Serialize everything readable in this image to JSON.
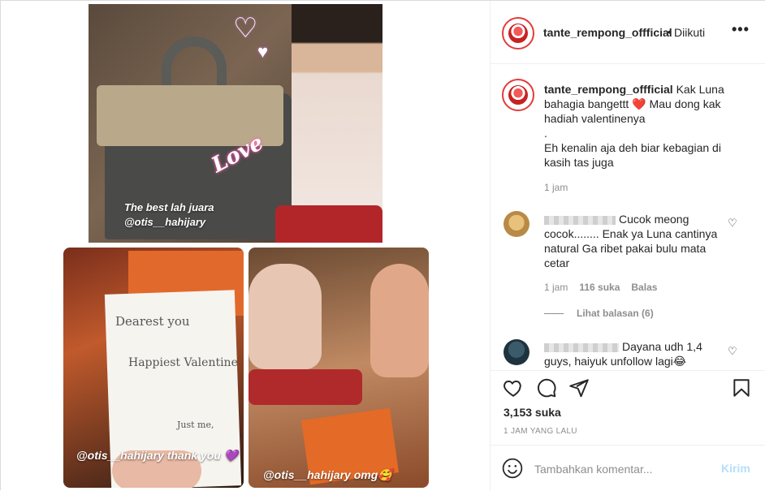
{
  "media": {
    "top_caption_1": "The best lah juara",
    "top_caption_2": "@otis__hahijary",
    "love_sticker": "Love",
    "card_line_1": "Dearest you",
    "card_line_2": "Happiest Valentine",
    "card_line_3": "Just me,",
    "bl_caption": "@otis__hahijary thank you 💜",
    "br_caption": "@otis__hahijary omg🥰"
  },
  "header": {
    "username": "tante_rempong_offficial",
    "separator": "•",
    "follow_label": "Diikuti",
    "more_icon": "more-horizontal-icon"
  },
  "caption": {
    "username": "tante_rempong_offficial",
    "text_1": "Kak Luna bahagia bangettt",
    "heart": "❤️",
    "text_2": "Mau dong kak hadiah valentinenya\n.\nEh kenalin aja deh biar kebagian di kasih tas juga",
    "time": "1 jam"
  },
  "comments": [
    {
      "text": "Cucok meong cocok........ Enak ya Luna cantinya natural Ga ribet pakai bulu mata cetar",
      "time": "1 jam",
      "likes": "116 suka",
      "reply_label": "Balas",
      "view_replies": "Lihat balasan (6)"
    },
    {
      "text": "Dayana udh 1,4 guys, haiyuk unfollow lagi😂"
    }
  ],
  "actions": {
    "likes": "3,153 suka",
    "date": "1 JAM YANG LALU"
  },
  "add_comment": {
    "placeholder": "Tambahkan komentar...",
    "post_label": "Kirim"
  }
}
